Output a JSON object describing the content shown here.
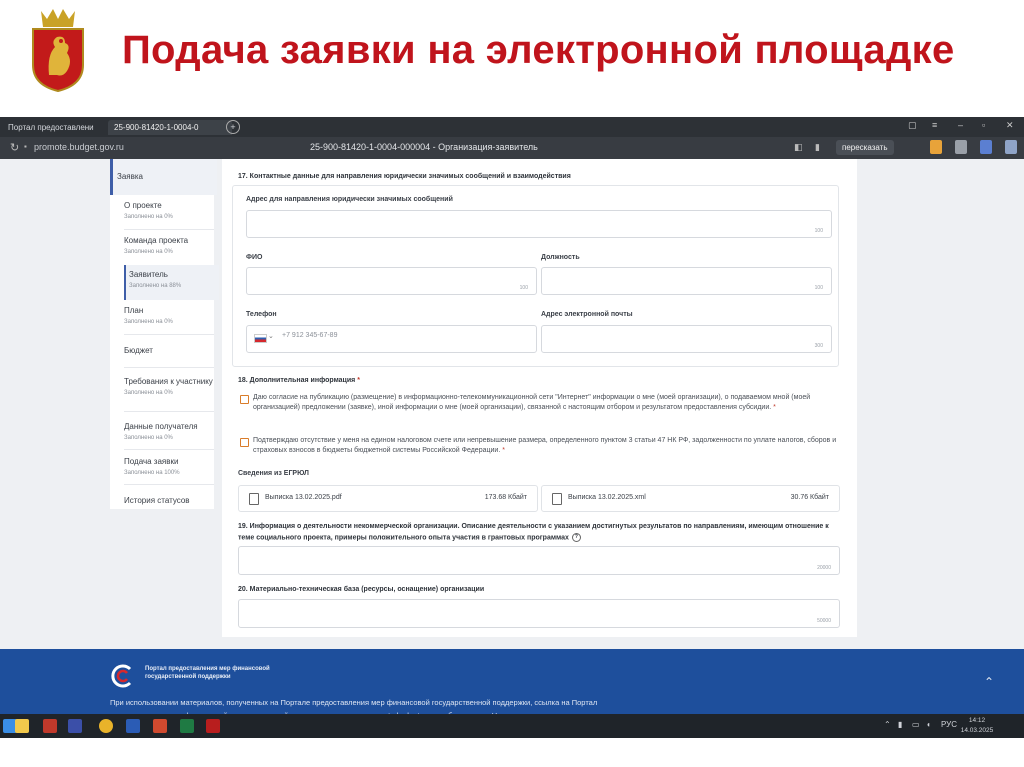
{
  "slide": {
    "title": "Подача заявки на электронной площадке"
  },
  "browser": {
    "tabs": [
      {
        "label": "Портал предоставлени"
      },
      {
        "label": "25-900-81420-1-0004-0"
      }
    ],
    "new_tab": "+",
    "url": "promote.budget.gov.ru",
    "page_title": "25-900-81420-1-0004-000004 - Организация-заявитель",
    "retell_button": "пересказать"
  },
  "sidebar": {
    "top": "Заявка",
    "items": [
      {
        "label": "О проекте",
        "sub": "Заполнено на 0%"
      },
      {
        "label": "Команда проекта",
        "sub": "Заполнено на 0%"
      },
      {
        "label": "Заявитель",
        "sub": "Заполнено на 88%"
      },
      {
        "label": "План",
        "sub": "Заполнено на 0%"
      },
      {
        "label": "Бюджет",
        "sub": ""
      },
      {
        "label": "Требования к участнику",
        "sub": "Заполнено на 0%"
      },
      {
        "label": "Данные получателя",
        "sub": "Заполнено на 0%"
      },
      {
        "label": "Подача заявки",
        "sub": "Заполнено на 100%"
      },
      {
        "label": "История статусов",
        "sub": ""
      }
    ]
  },
  "form": {
    "s17_heading": "17. Контактные данные для направления юридически значимых сообщений и взаимодействия",
    "address_label": "Адрес для направления юридически значимых сообщений",
    "address_count": "100",
    "fio_label": "ФИО",
    "fio_count": "100",
    "position_label": "Должность",
    "position_count": "100",
    "phone_label": "Телефон",
    "phone_placeholder": "+7 912 345-67-89",
    "email_label": "Адрес электронной почты",
    "email_count": "300",
    "s18_heading": "18. Дополнительная информация",
    "required_mark": "*",
    "consent_1": "Даю согласие на публикацию (размещение) в информационно-телекоммуникационной сети \"Интернет\" информации о мне (моей организации), о подаваемом мной (моей организацией) предложении (заявке), иной информации о мне (моей организации), связанной с настоящим отбором и результатом предоставления субсидии.",
    "consent_2": "Подтверждаю отсутствие у меня на едином налоговом счете или непревышение размера, определенного пунктом 3 статьи 47 НК РФ, задолженности по уплате налогов, сборов и страховых взносов в бюджеты бюджетной системы Российской Федерации.",
    "egrul_label": "Сведения из ЕГРЮЛ",
    "files": [
      {
        "name": "Выписка 13.02.2025.pdf",
        "size": "173.68 Кбайт"
      },
      {
        "name": "Выписка 13.02.2025.xml",
        "size": "30.76 Кбайт"
      }
    ],
    "s19_heading_line1": "19. Информация о деятельности некоммерческой организации. Описание деятельности с указанием достигнутых результатов по направлениям, имеющим отношение к",
    "s19_heading_line2": "теме социального проекта, примеры положительного опыта участия в грантовых программах",
    "s19_help": "?",
    "s19_count": "20000",
    "s20_heading": "20. Материально-техническая база (ресурсы, оснащение) организации",
    "s20_count": "50000"
  },
  "footer": {
    "portal_name": "Портал предоставления мер финансовой государственной поддержки",
    "note": "При использовании материалов, полученных на Портале предоставления мер финансовой государственной поддержки, ссылка на Портал предоставления мер финансовой государственной поддержки по адресу promote.budget.gov.ru обязательна. Не допускается внесение"
  },
  "taskbar": {
    "lang": "РУС",
    "time": "14:12",
    "date": "14.03.2025"
  },
  "colors": {
    "title_red": "#c0141c",
    "footer_blue": "#1e4f9c",
    "checkbox_orange": "#d97c2a",
    "accent_blue": "#3e5ea8"
  }
}
